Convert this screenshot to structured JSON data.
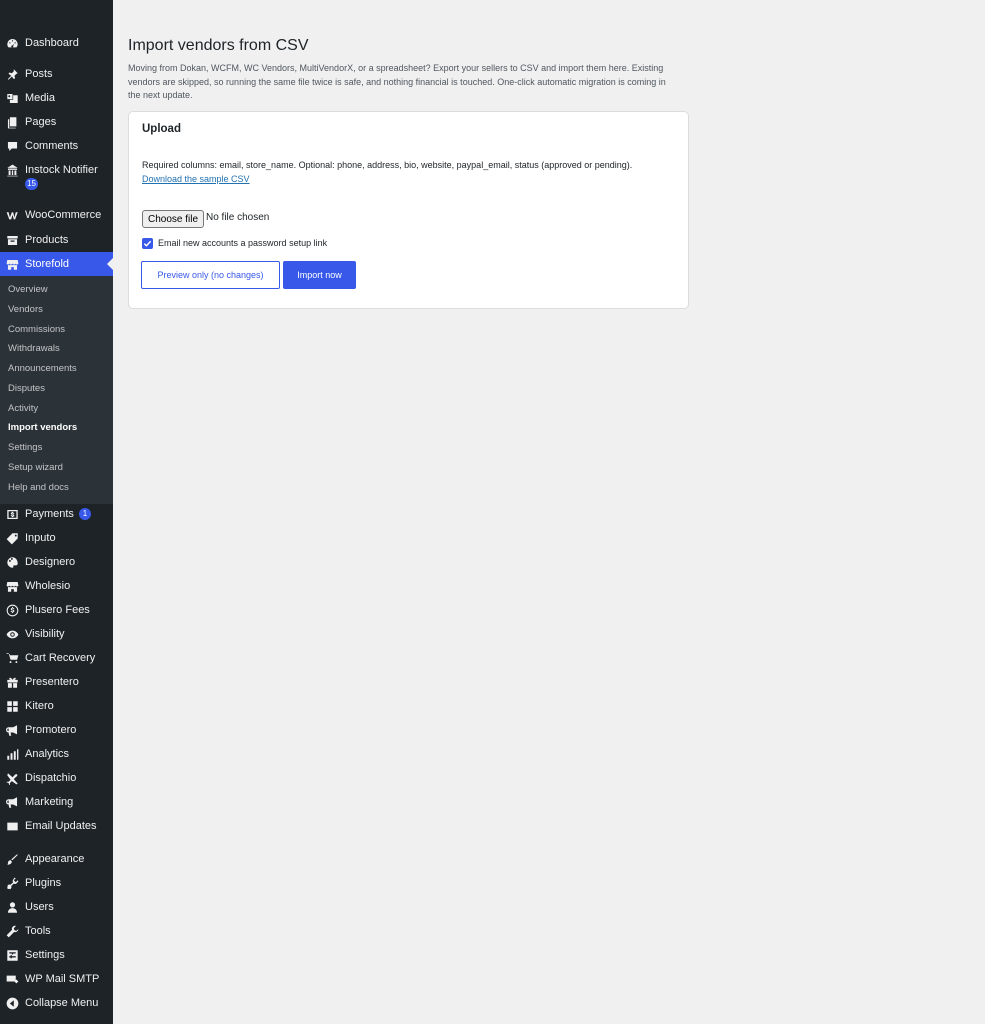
{
  "sidebar": {
    "items": [
      {
        "label": "Dashboard",
        "icon": "dashboard-icon"
      },
      {
        "label": "Posts",
        "icon": "pin-icon"
      },
      {
        "label": "Media",
        "icon": "media-icon"
      },
      {
        "label": "Pages",
        "icon": "pages-icon"
      },
      {
        "label": "Comments",
        "icon": "comment-icon"
      },
      {
        "label": "Instock Notifier",
        "icon": "store-icon",
        "badge": "15"
      },
      {
        "label": "WooCommerce",
        "icon": "woocommerce-icon"
      },
      {
        "label": "Products",
        "icon": "archive-icon"
      },
      {
        "label": "Storefold",
        "icon": "storefront-icon",
        "active": true
      },
      {
        "label": "Payments",
        "icon": "payment-icon",
        "badge": "1"
      },
      {
        "label": "Inputo",
        "icon": "tag-icon"
      },
      {
        "label": "Designero",
        "icon": "palette-icon"
      },
      {
        "label": "Wholesio",
        "icon": "storefront-icon"
      },
      {
        "label": "Plusero Fees",
        "icon": "dollar-icon"
      },
      {
        "label": "Visibility",
        "icon": "eye-icon"
      },
      {
        "label": "Cart Recovery",
        "icon": "cart-icon"
      },
      {
        "label": "Presentero",
        "icon": "gift-icon"
      },
      {
        "label": "Kitero",
        "icon": "grid-icon"
      },
      {
        "label": "Promotero",
        "icon": "megaphone-icon"
      },
      {
        "label": "Analytics",
        "icon": "chart-icon"
      },
      {
        "label": "Dispatchio",
        "icon": "plane-icon"
      },
      {
        "label": "Marketing",
        "icon": "megaphone-icon"
      },
      {
        "label": "Email Updates",
        "icon": "envelope-icon"
      },
      {
        "label": "Appearance",
        "icon": "brush-icon"
      },
      {
        "label": "Plugins",
        "icon": "plugin-icon"
      },
      {
        "label": "Users",
        "icon": "user-icon"
      },
      {
        "label": "Tools",
        "icon": "wrench-icon"
      },
      {
        "label": "Settings",
        "icon": "settings-icon"
      },
      {
        "label": "WP Mail SMTP",
        "icon": "mail-icon"
      },
      {
        "label": "Collapse Menu",
        "icon": "collapse-icon"
      }
    ],
    "submenu": [
      "Overview",
      "Vendors",
      "Commissions",
      "Withdrawals",
      "Announcements",
      "Disputes",
      "Activity",
      "Import vendors",
      "Settings",
      "Setup wizard",
      "Help and docs"
    ],
    "current_submenu": "Import vendors"
  },
  "page": {
    "title": "Import vendors from CSV",
    "intro": "Moving from Dokan, WCFM, WC Vendors, MultiVendorX, or a spreadsheet? Export your sellers to CSV and import them here. Existing vendors are skipped, so running the same file twice is safe, and nothing financial is touched. One-click automatic migration is coming in the next update."
  },
  "card": {
    "title": "Upload",
    "required_text": "Required columns: email, store_name. Optional: phone, address, bio, website, paypal_email, status (approved or pending).",
    "sample_link": "Download the sample CSV",
    "file_button": "Choose file",
    "file_status": "No file chosen",
    "email_checkbox_label": "Email new accounts a password setup link",
    "email_checkbox_checked": true,
    "preview_button": "Preview only (no changes)",
    "import_button": "Import now"
  },
  "colors": {
    "accent": "#3858e9",
    "sidebar_bg": "#1d2327",
    "submenu_bg": "#2c3338",
    "page_bg": "#f0f0f1",
    "link": "#2271b1"
  }
}
